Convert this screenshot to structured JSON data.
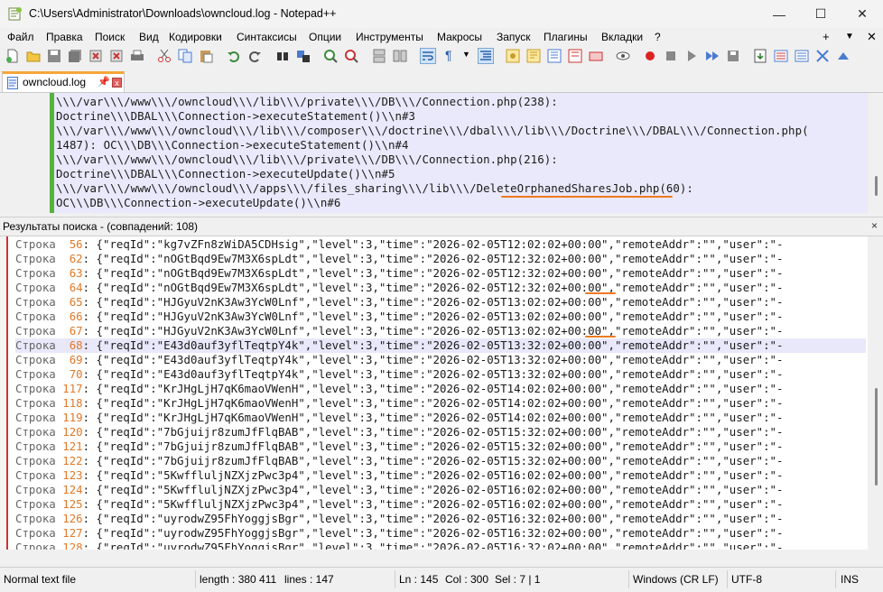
{
  "window": {
    "title": "C:\\Users\\Administrator\\Downloads\\owncloud.log - Notepad++",
    "minimize": "—",
    "maximize": "☐",
    "close": "✕"
  },
  "menu": {
    "items": [
      "Файл",
      "Правка",
      "Поиск",
      "Вид",
      "Кодировки",
      "Синтаксисы",
      "Опции",
      "Инструменты",
      "Макросы",
      "Запуск",
      "Плагины",
      "Вкладки",
      "?"
    ],
    "right": [
      "+",
      "▼",
      "✕"
    ]
  },
  "tab": {
    "label": "owncloud.log",
    "pin": "📌",
    "close": "x"
  },
  "editor": {
    "lines": [
      "\\\\\\/var\\\\\\/www\\\\\\/owncloud\\\\\\/lib\\\\\\/private\\\\\\/DB\\\\\\/Connection.php(238):",
      "Doctrine\\\\\\DBAL\\\\\\Connection->executeStatement()\\\\n#3",
      "\\\\\\/var\\\\\\/www\\\\\\/owncloud\\\\\\/lib\\\\\\/composer\\\\\\/doctrine\\\\\\/dbal\\\\\\/lib\\\\\\/Doctrine\\\\\\/DBAL\\\\\\/Connection.php(",
      "1487): OC\\\\\\DB\\\\\\Connection->executeStatement()\\\\n#4",
      "\\\\\\/var\\\\\\/www\\\\\\/owncloud\\\\\\/lib\\\\\\/private\\\\\\/DB\\\\\\/Connection.php(216):",
      "Doctrine\\\\\\DBAL\\\\\\Connection->executeUpdate()\\\\n#5",
      "\\\\\\/var\\\\\\/www\\\\\\/owncloud\\\\\\/apps\\\\\\/files_sharing\\\\\\/lib\\\\\\/DeleteOrphanedSharesJob.php(60):",
      "OC\\\\\\DB\\\\\\Connection->executeUpdate()\\\\n#6"
    ]
  },
  "results": {
    "title": "Результаты поиска - (совпадений: 108)",
    "close": "×",
    "prefix": "Строка",
    "rows": [
      {
        "n": "56",
        "reqid": "kg7vZFn8zWiDA5CDHsig",
        "time": "2026-02-05T12:02:02+00:00"
      },
      {
        "n": "62",
        "reqid": "nOGtBqd9Ew7M3X6spLdt",
        "time": "2026-02-05T12:32:02+00:00"
      },
      {
        "n": "63",
        "reqid": "nOGtBqd9Ew7M3X6spLdt",
        "time": "2026-02-05T12:32:02+00:00"
      },
      {
        "n": "64",
        "reqid": "nOGtBqd9Ew7M3X6spLdt",
        "time": "2026-02-05T12:32:02+00:00"
      },
      {
        "n": "65",
        "reqid": "HJGyuV2nK3Aw3YcW0Lnf",
        "time": "2026-02-05T13:02:02+00:00"
      },
      {
        "n": "66",
        "reqid": "HJGyuV2nK3Aw3YcW0Lnf",
        "time": "2026-02-05T13:02:02+00:00"
      },
      {
        "n": "67",
        "reqid": "HJGyuV2nK3Aw3YcW0Lnf",
        "time": "2026-02-05T13:02:02+00:00"
      },
      {
        "n": "68",
        "reqid": "E43d0auf3yflTeqtpY4k",
        "time": "2026-02-05T13:32:02+00:00"
      },
      {
        "n": "69",
        "reqid": "E43d0auf3yflTeqtpY4k",
        "time": "2026-02-05T13:32:02+00:00"
      },
      {
        "n": "70",
        "reqid": "E43d0auf3yflTeqtpY4k",
        "time": "2026-02-05T13:32:02+00:00"
      },
      {
        "n": "117",
        "reqid": "KrJHgLjH7qK6maoVWenH",
        "time": "2026-02-05T14:02:02+00:00"
      },
      {
        "n": "118",
        "reqid": "KrJHgLjH7qK6maoVWenH",
        "time": "2026-02-05T14:02:02+00:00"
      },
      {
        "n": "119",
        "reqid": "KrJHgLjH7qK6maoVWenH",
        "time": "2026-02-05T14:02:02+00:00"
      },
      {
        "n": "120",
        "reqid": "7bGjuijr8zumJfFlqBAB",
        "time": "2026-02-05T15:32:02+00:00"
      },
      {
        "n": "121",
        "reqid": "7bGjuijr8zumJfFlqBAB",
        "time": "2026-02-05T15:32:02+00:00"
      },
      {
        "n": "122",
        "reqid": "7bGjuijr8zumJfFlqBAB",
        "time": "2026-02-05T15:32:02+00:00"
      },
      {
        "n": "123",
        "reqid": "5KwffluljNZXjzPwc3p4",
        "time": "2026-02-05T16:02:02+00:00"
      },
      {
        "n": "124",
        "reqid": "5KwffluljNZXjzPwc3p4",
        "time": "2026-02-05T16:02:02+00:00"
      },
      {
        "n": "125",
        "reqid": "5KwffluljNZXjzPwc3p4",
        "time": "2026-02-05T16:02:02+00:00"
      },
      {
        "n": "126",
        "reqid": "uyrodwZ95FhYoggjsBgr",
        "time": "2026-02-05T16:32:02+00:00"
      },
      {
        "n": "127",
        "reqid": "uyrodwZ95FhYoggjsBgr",
        "time": "2026-02-05T16:32:02+00:00"
      },
      {
        "n": "128",
        "reqid": "uyrodwZ95FhYoggjsBgr",
        "time": "2026-02-05T16:32:02+00:00"
      }
    ],
    "selected_line": "68"
  },
  "status": {
    "type": "Normal text file",
    "length": "length : 380 411",
    "lines": "lines : 147",
    "ln": "Ln : 145",
    "col": "Col : 300",
    "sel": "Sel : 7 | 1",
    "eol": "Windows (CR LF)",
    "encoding": "UTF-8",
    "mode": "INS"
  },
  "colors": {
    "accent_underline": "#f07a20",
    "fold_margin": "#53b33a",
    "editor_bg": "#e9e9fb",
    "tab_accent": "#f7a63a"
  }
}
